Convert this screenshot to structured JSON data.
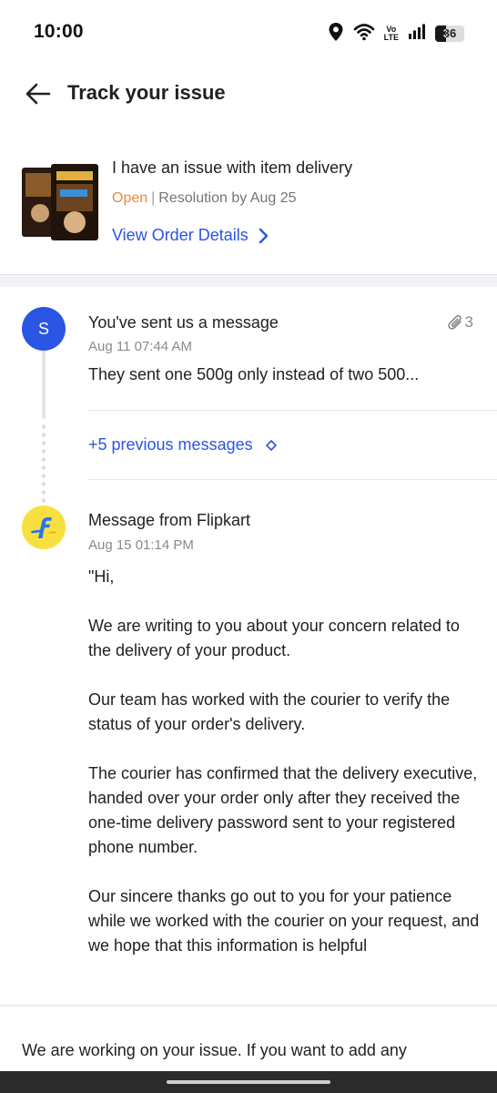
{
  "status_bar": {
    "time": "10:00",
    "volte_top": "Vo",
    "volte_bottom": "LTE",
    "battery": "36",
    "battery_level": 0.36,
    "icons": [
      "location-icon",
      "wifi-icon",
      "volte-icon",
      "signal-icon",
      "battery-icon"
    ]
  },
  "header": {
    "title": "Track your issue"
  },
  "issue": {
    "title": "I have an issue with item delivery",
    "status": "Open",
    "resolution": "Resolution by Aug 25",
    "view_order_label": "View Order Details"
  },
  "messages": [
    {
      "avatar": "S",
      "title": "You've sent us a message",
      "attachments": "3",
      "time": "Aug 11 07:44 AM",
      "text": "They sent one 500g only instead of two 500..."
    },
    {
      "title": "Message from Flipkart",
      "time": "Aug 15 01:14 PM",
      "paragraphs": [
        "\"Hi,",
        "We are writing to you about your concern related to the delivery of your product.",
        "Our team has worked with the courier to verify the status of your order's delivery.",
        "The courier has confirmed that the delivery executive, handed over your order only after they received the one-time delivery password sent to your registered phone number.",
        "Our sincere thanks go out to you for your patience while we worked with the courier on your request, and we hope that this information is helpful"
      ]
    }
  ],
  "previous_messages_label": "+5 previous messages",
  "footer": {
    "text": "We are working on your issue. If you want to add any"
  },
  "colors": {
    "accent": "#2a55e5",
    "open_status": "#e88a3c",
    "flipkart_yellow": "#f8e042",
    "flipkart_blue": "#2874f0"
  }
}
